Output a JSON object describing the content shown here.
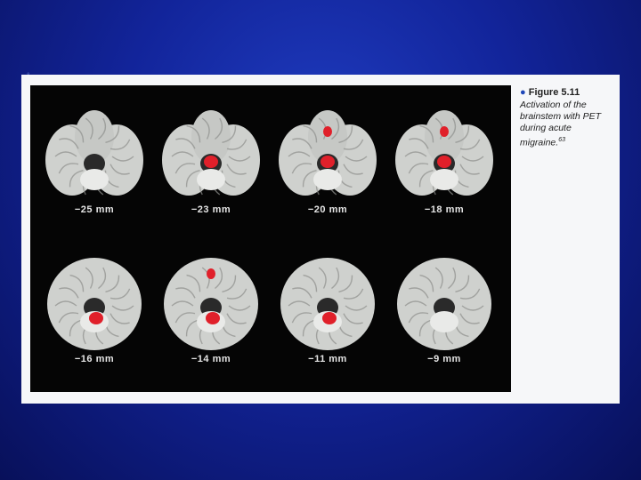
{
  "figure": {
    "title": "Figure 5.11",
    "caption": "Activation of the brainstem with PET during acute migraine.",
    "reference": "63"
  },
  "slices": [
    {
      "label": "−25 mm",
      "activations": []
    },
    {
      "label": "−23 mm",
      "activations": [
        "brainstem"
      ]
    },
    {
      "label": "−20 mm",
      "activations": [
        "brainstem",
        "frontal"
      ]
    },
    {
      "label": "−18 mm",
      "activations": [
        "brainstem",
        "frontal"
      ]
    },
    {
      "label": "−16 mm",
      "activations": [
        "brainstem"
      ]
    },
    {
      "label": "−14 mm",
      "activations": [
        "brainstem",
        "frontal"
      ]
    },
    {
      "label": "−11 mm",
      "activations": [
        "brainstem"
      ]
    },
    {
      "label": "−9 mm",
      "activations": []
    }
  ],
  "colors": {
    "slide_background": "#12249a",
    "figure_background": "#f6f7f9",
    "scan_background": "#050505",
    "activation": "#e0202a",
    "tissue": "#c9cbc8"
  }
}
